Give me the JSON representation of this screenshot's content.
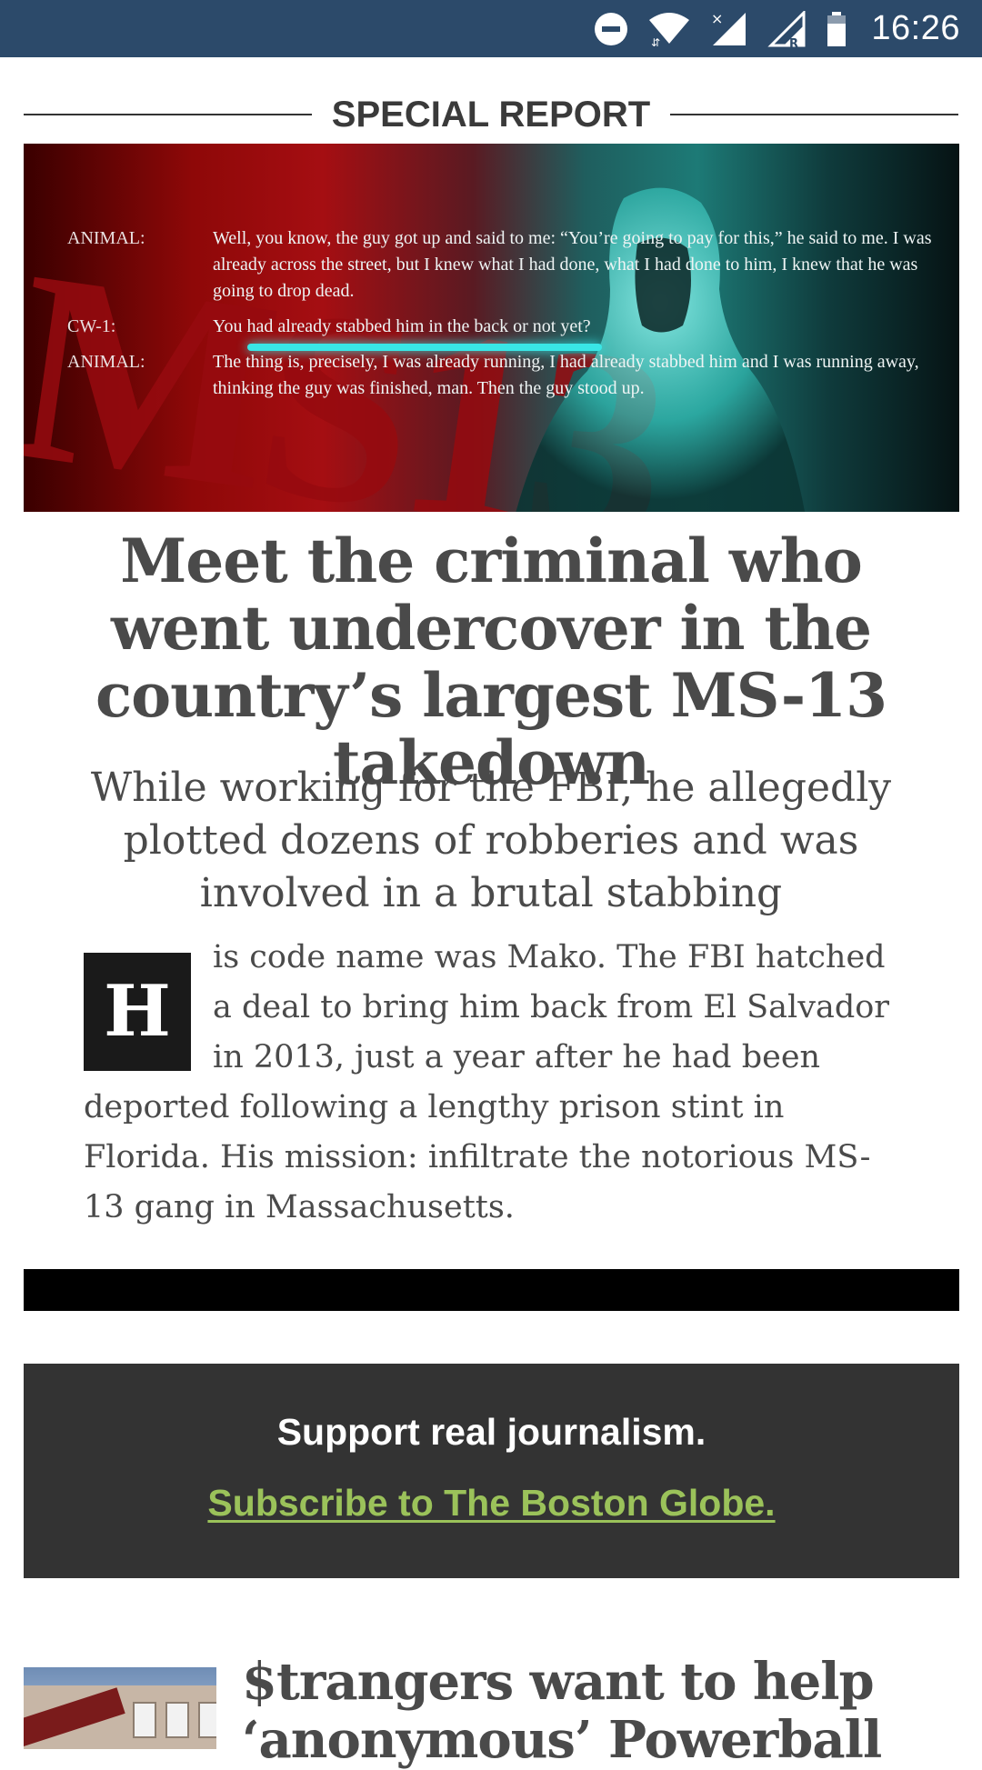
{
  "status_bar": {
    "time": "16:26",
    "icons": [
      "do-not-disturb-icon",
      "wifi-icon",
      "signal-no-service-icon",
      "signal-roaming-icon",
      "battery-icon"
    ]
  },
  "section": {
    "label": "SPECIAL REPORT"
  },
  "hero": {
    "graffiti": "MS13",
    "transcript": [
      {
        "speaker": "ANIMAL:",
        "text": "Well, you know, the guy got up and said to me: “You’re going to pay for this,” he said to me. I was already across the street, but I knew what I had done, what I had done to him, I knew that he was going to drop dead."
      },
      {
        "speaker": "CW-1:",
        "text": "You had already stabbed him in the back or not yet?"
      },
      {
        "speaker": "ANIMAL:",
        "text": "The thing is, precisely, I was already running, I had already stabbed him and I was running away, thinking the guy was finished, man. Then the guy stood up."
      }
    ],
    "colors": {
      "red": "#a50e12",
      "teal": "#1d7a76",
      "glow": "#39e6e6"
    }
  },
  "article": {
    "headline": "Meet the criminal who went undercover in the country’s largest MS-13 takedown",
    "dek": "While working for the FBI, he allegedly plotted dozens of robberies and was involved in a brutal stabbing",
    "dropcap": "H",
    "lede": "is code name was Mako. The FBI hatched a deal to bring him back from El Salvador in 2013, just a year after he had been deported following a lengthy prison stint in Florida. His mission: infiltrate the notorious MS-13 gang in Massachusetts."
  },
  "promo": {
    "title": "Support real journalism.",
    "link": "Subscribe to The Boston Globe.",
    "link_color": "#9bc25a",
    "background": "#333333"
  },
  "next_story": {
    "headline": "$trangers want to help ‘anonymous’ Powerball"
  }
}
